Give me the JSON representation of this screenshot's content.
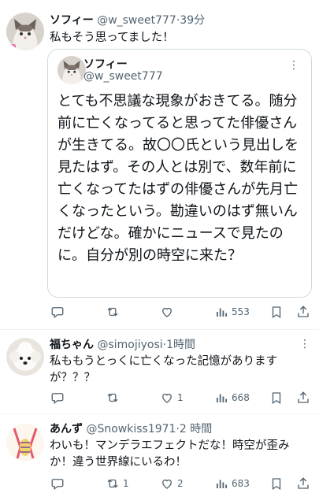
{
  "tweets": [
    {
      "name": "ソフィー",
      "handle": "@w_sweet777",
      "time": "39分",
      "text": "私もそう思ってました！",
      "quote": {
        "name": "ソフィー",
        "handle": "@w_sweet777",
        "text": "とても不思議な現象がおきてる。随分前に亡くなってると思ってた俳優さんが生きてる。故〇〇氏という見出しを見たはず。その人とは別で、数年前に亡くなってたはずの俳優さんが先月亡くなったという。勘違いのはず無いんだけどな。確かにニュースで見たのに。自分が別の時空に来た？"
      },
      "actions": {
        "reply": "",
        "retweet": "",
        "like": "",
        "views": "553"
      }
    },
    {
      "name": "福ちゃん",
      "handle": "@simojiyosi",
      "time": "1時間",
      "text": "私ももうとっくに亡くなった記憶がありますが？？？",
      "actions": {
        "reply": "",
        "retweet": "",
        "like": "1",
        "views": "668"
      }
    },
    {
      "name": "あんず",
      "handle": "@Snowkiss1971",
      "time": "2 時間",
      "text": "わいも！マンデラエフェクトだな！時空が歪みか！違う世界線にいるわ！",
      "actions": {
        "reply": "",
        "retweet": "1",
        "like": "2",
        "views": "683"
      }
    }
  ],
  "colors": {
    "text": "#0f1419",
    "secondary": "#536471",
    "border": "#cfd9de"
  }
}
